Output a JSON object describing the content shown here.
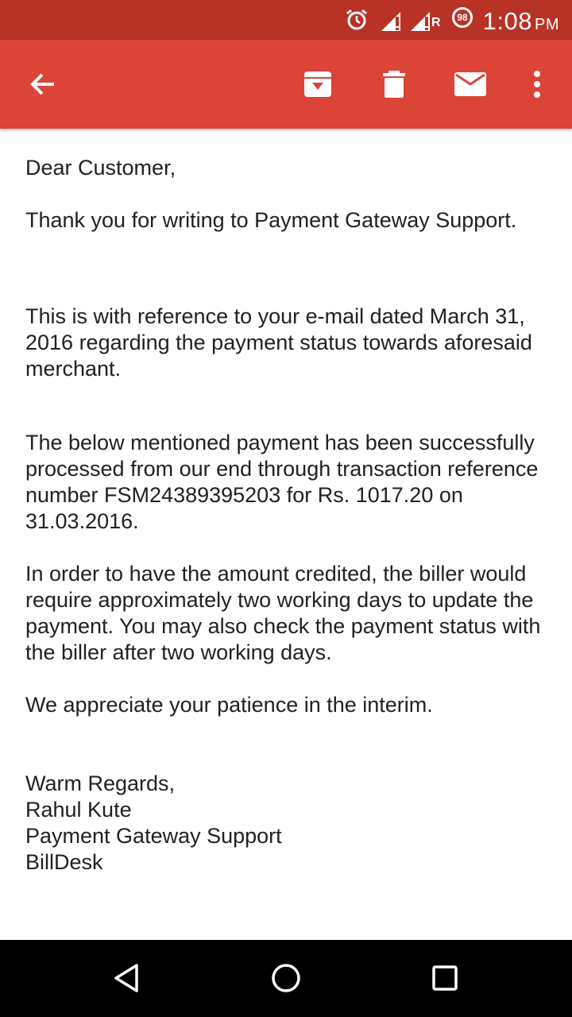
{
  "status_bar": {
    "time": "1:08",
    "ampm": "PM",
    "battery_level": "98",
    "signal_label": "R"
  },
  "colors": {
    "status_bar": "#b93226",
    "app_bar": "#db4437",
    "text": "#212121",
    "nav_bar": "#000000"
  },
  "toolbar": {
    "icons": [
      "back-arrow-icon",
      "archive-icon",
      "delete-icon",
      "mark-unread-icon",
      "more-options-icon"
    ]
  },
  "email": {
    "greeting": "Dear Customer,",
    "thanks": "Thank you for writing to Payment Gateway Support.",
    "paragraph_reference": "This is with reference to your e-mail dated March 31, 2016 regarding the payment status towards aforesaid merchant.",
    "paragraph_processed": "The below mentioned payment has been successfully processed from our end through transaction reference number FSM24389395203 for Rs. 1017.20 on 31.03.2016.",
    "paragraph_credit": "In order to have the amount credited, the biller would require approximately two working days to update the payment. You may also check the payment status with the biller after two working days.",
    "paragraph_patience": "We appreciate your patience in the interim.",
    "signature": [
      "Warm Regards,",
      "Rahul Kute",
      "Payment Gateway Support",
      "BillDesk"
    ]
  },
  "navigation": {
    "icons": [
      "back-triangle-icon",
      "home-circle-icon",
      "recents-square-icon"
    ]
  }
}
